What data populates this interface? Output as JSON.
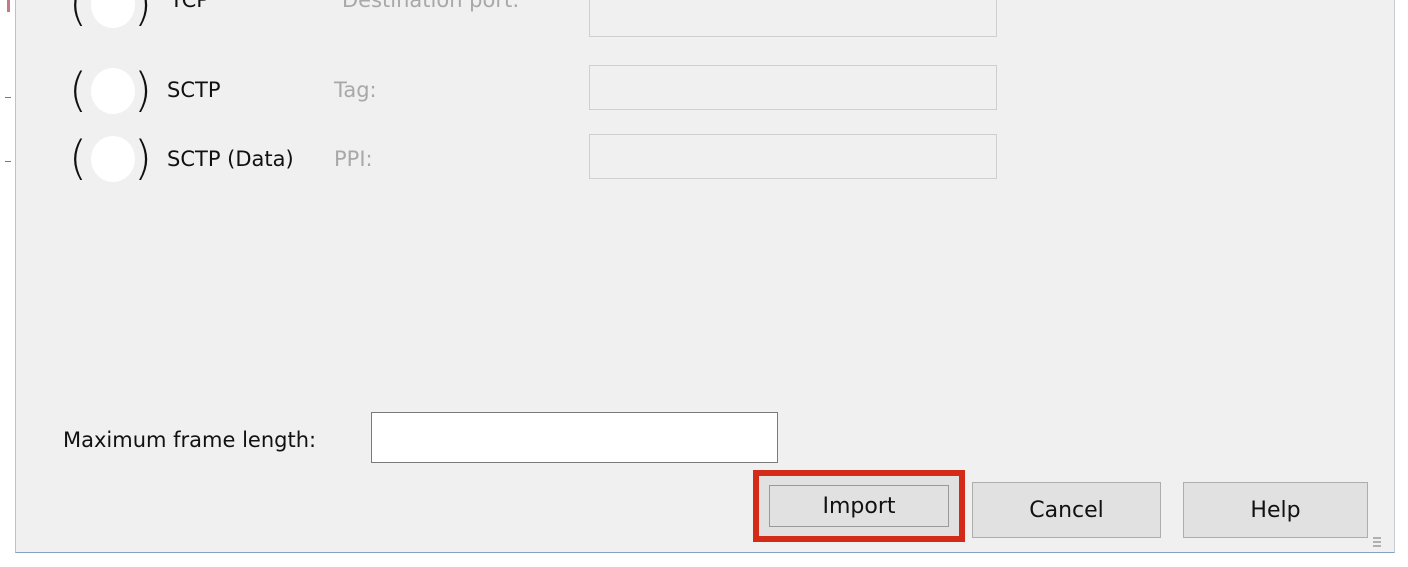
{
  "protocols": [
    {
      "label": "TCP",
      "field_label": "Destination port:",
      "field_value": ""
    },
    {
      "label": "SCTP",
      "field_label": "Tag:",
      "field_value": ""
    },
    {
      "label": "SCTP (Data)",
      "field_label": "PPI:",
      "field_value": ""
    }
  ],
  "max_frame_length": {
    "label": "Maximum frame length:",
    "value": ""
  },
  "buttons": {
    "import": "Import",
    "cancel": "Cancel",
    "help": "Help"
  },
  "colors": {
    "dialog_bg": "#f0f0f0",
    "highlight_border": "#d32b17"
  }
}
